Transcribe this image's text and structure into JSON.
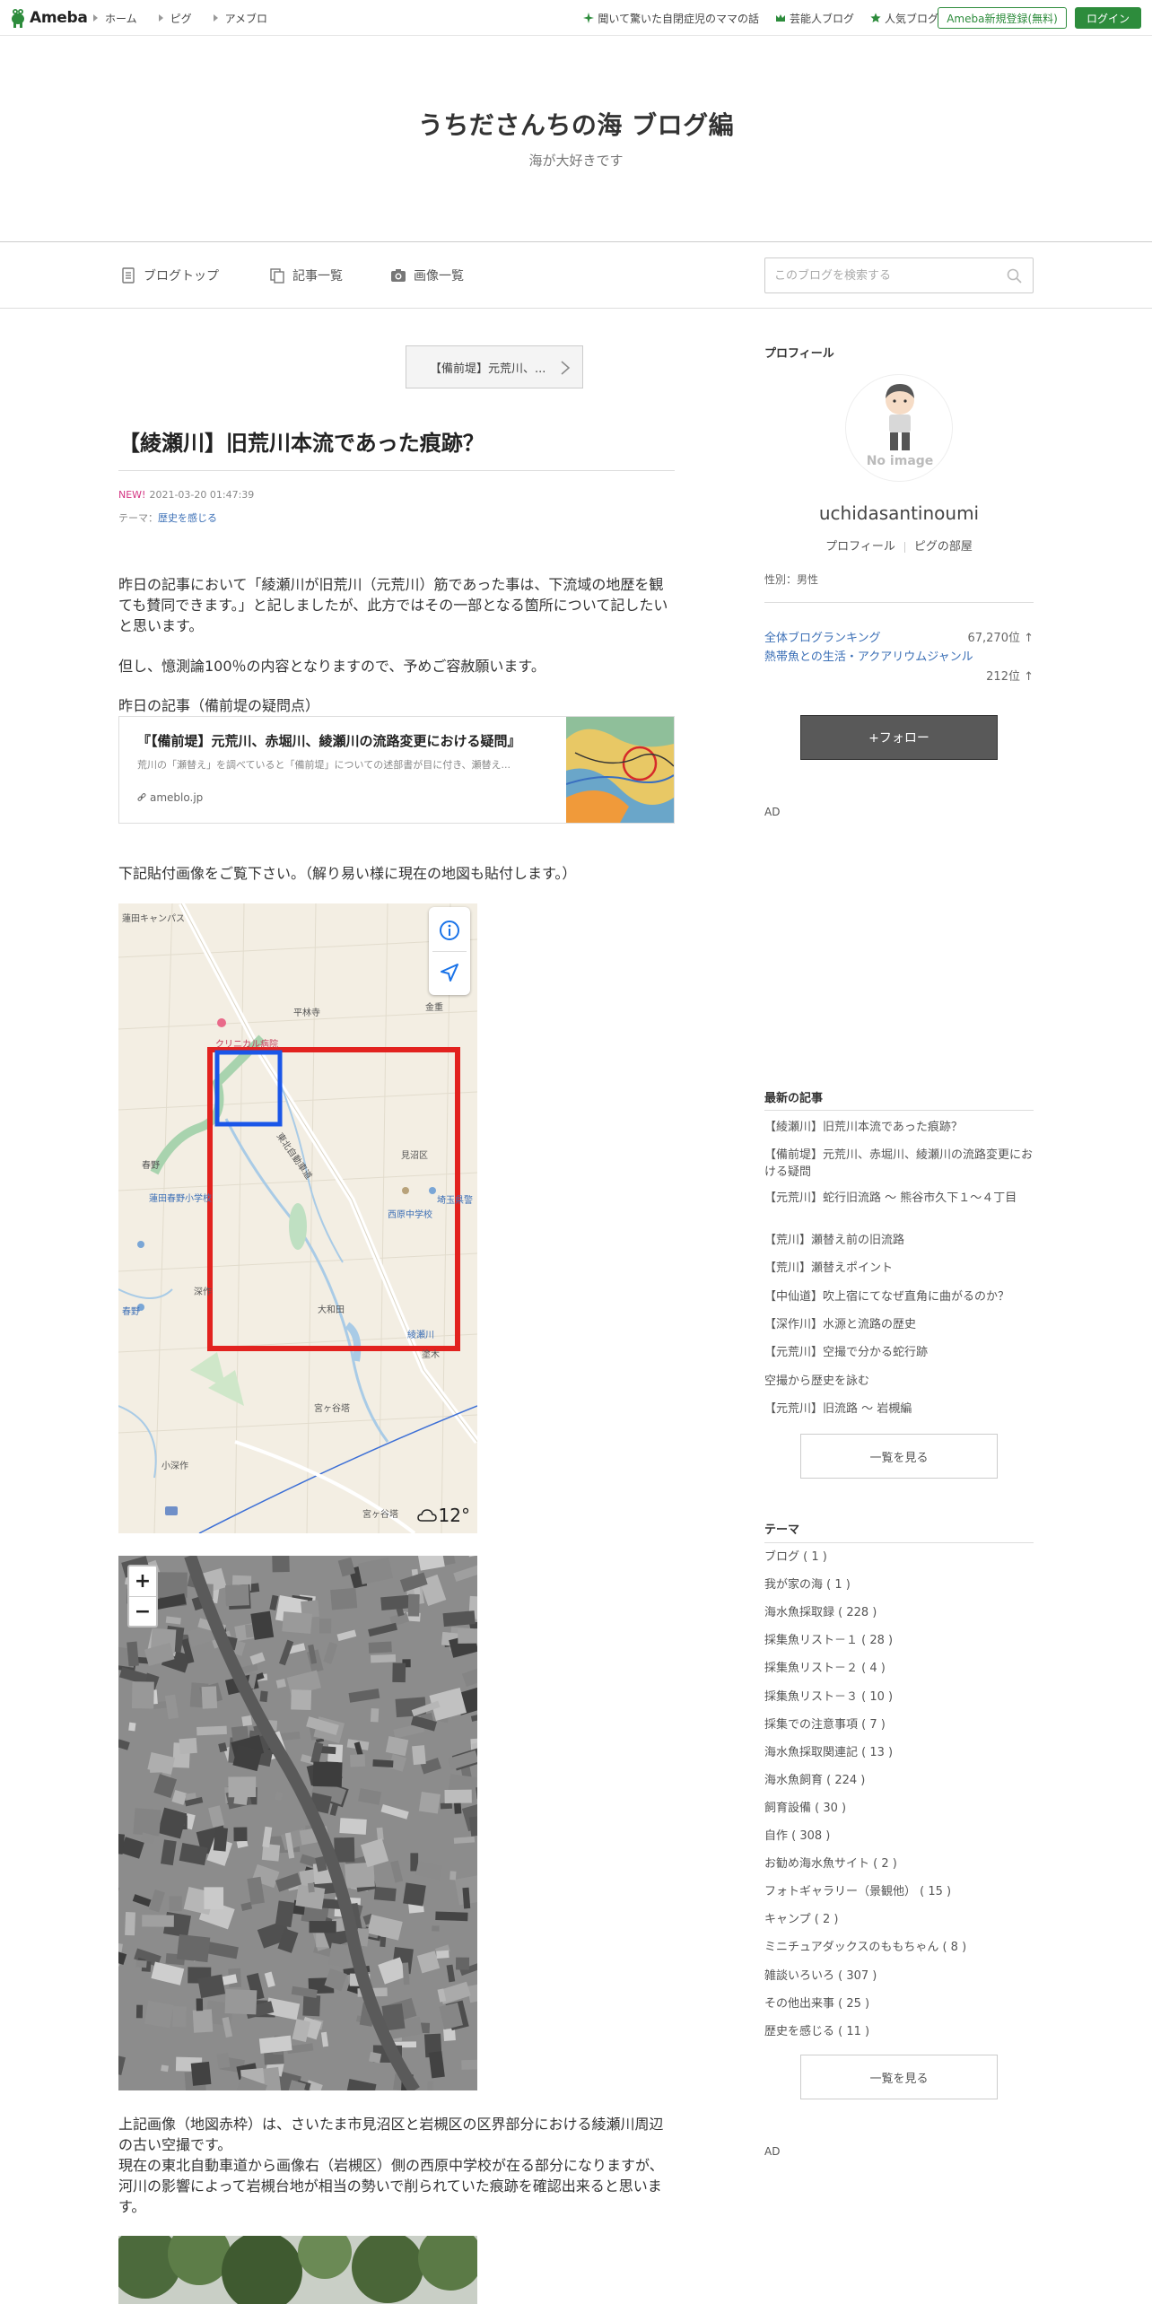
{
  "topbar": {
    "logo_text": "Ameba",
    "nav": [
      "ホーム",
      "ピグ",
      "アメブロ"
    ],
    "links": [
      {
        "label": "聞いて驚いた自閉症児のママの話",
        "icon": "sparkle-icon"
      },
      {
        "label": "芸能人ブログ",
        "icon": "crown-icon"
      },
      {
        "label": "人気ブログ",
        "icon": "star-icon"
      }
    ],
    "register_label": "Ameba新規登録(無料)",
    "login_label": "ログイン",
    "accent": "#2d8c3c"
  },
  "blog": {
    "title": "うちださんちの海 ブログ編",
    "description": "海が大好きです"
  },
  "blog_nav": {
    "top_label": "ブログトップ",
    "entries_label": "記事一覧",
    "images_label": "画像一覧",
    "search_placeholder": "このブログを検索する"
  },
  "article": {
    "prev_label": "【備前堤】元荒川、...",
    "title": "【綾瀬川】旧荒川本流であった痕跡？",
    "new_badge": "NEW!",
    "datetime": "2021-03-20 01:47:39",
    "theme_prefix": "テーマ：",
    "theme": "歴史を感じる",
    "p1": "昨日の記事において「綾瀬川が旧荒川（元荒川）筋であった事は、下流域の地歴を観ても賛同できます。」と記しましたが、此方ではその一部となる箇所について記したいと思います。",
    "p2": "但し、憶測論100％の内容となりますので、予めご容赦願います。",
    "p3": "昨日の記事（備前堤の疑問点）",
    "card": {
      "title": "『【備前堤】元荒川、赤堀川、綾瀬川の流路変更における疑問』",
      "desc": "荒川の「瀬替え」を調べていると「備前堤」についての述部書が目に付き、瀬替え...",
      "domain": "ameblo.jp"
    },
    "p4": "下記貼付画像をご覧下さい。（解り易い様に現在の地図も貼付します。）",
    "map_labels": [
      "蓮田キャンパス",
      "平林寺",
      "金重",
      "クリニカル病院",
      "東北自動車道",
      "春野",
      "蓮田春野小学校",
      "西原中学校",
      "埼玉県警",
      "深作",
      "春野",
      "見沼区",
      "綾瀬川",
      "大和田",
      "宮ヶ谷塔",
      "小深作",
      "宮ヶ谷塔",
      "塗木"
    ],
    "weather": "12°",
    "p5a": "上記画像（地図赤枠）は、さいたま市見沼区と岩槻区の区界部分における綾瀬川周辺の古い空撮です。",
    "p5b": "現在の東北自動車道から画像右（岩槻区）側の西原中学校が在る部分になりますが、河川の影響によって岩槻台地が相当の勢いで削られていた痕跡を確認出来ると思います。",
    "zoom_in": "+",
    "zoom_out": "−"
  },
  "sidebar": {
    "profile_heading": "プロフィール",
    "avatar_text": "No image",
    "name": "uchidasantinoumi",
    "profile_link": "プロフィール",
    "pig_link": "ピグの部屋",
    "sex": "性別：男性",
    "rank_all_label": "全体ブログランキング",
    "rank_all_value": "67,270位 ↑",
    "rank_genre_label": "熱帯魚との生活・アクアリウムジャンル",
    "rank_genre_value": "212位 ↑",
    "follow_label": "+フォロー",
    "ad1": "AD",
    "recent_heading": "最新の記事",
    "recent": [
      "【綾瀬川】旧荒川本流であった痕跡？",
      "【備前堤】元荒川、赤堀川、綾瀬川の流路変更における疑問",
      "【元荒川】蛇行旧流路 〜 熊谷市久下１〜４丁目",
      "【荒川】瀬替え前の旧流路",
      "【荒川】瀬替えポイント",
      "【中仙道】吹上宿にてなぜ直角に曲がるのか？",
      "【深作川】水源と流路の歴史",
      "【元荒川】空撮で分かる蛇行跡",
      "空撮から歴史を詠む",
      "【元荒川】旧流路 〜 岩槻編"
    ],
    "recent_more": "一覧を見る",
    "theme_heading": "テーマ",
    "themes": [
      "ブログ ( 1 )",
      "我が家の海 ( 1 )",
      "海水魚採取録 ( 228 )",
      "採集魚リスト－１ ( 28 )",
      "採集魚リスト－２ ( 4 )",
      "採集魚リスト－３ ( 10 )",
      "採集での注意事項 ( 7 )",
      "海水魚採取関連記 ( 13 )",
      "海水魚飼育 ( 224 )",
      "飼育設備 ( 30 )",
      "自作 ( 308 )",
      "お勧め海水魚サイト ( 2 )",
      "フォトギャラリー（景観他） ( 15 )",
      "キャンプ ( 2 )",
      "ミニチュアダックスのももちゃん ( 8 )",
      "雑談いろいろ ( 307 )",
      "その他出来事 ( 25 )",
      "歴史を感じる ( 11 )"
    ],
    "themes_more": "一覧を見る",
    "ad2": "AD"
  }
}
